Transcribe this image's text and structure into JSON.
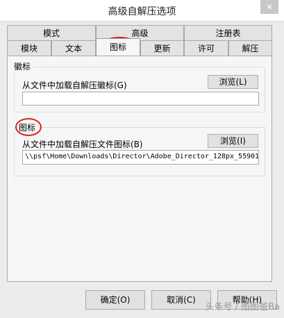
{
  "window": {
    "title": "高级自解压选项"
  },
  "tabs_row1": [
    {
      "label": "模式"
    },
    {
      "label": "高级"
    },
    {
      "label": "注册表"
    }
  ],
  "tabs_row2": [
    {
      "label": "模块"
    },
    {
      "label": "文本"
    },
    {
      "label": "图标",
      "active": true
    },
    {
      "label": "更新"
    },
    {
      "label": "许可"
    },
    {
      "label": "解压"
    }
  ],
  "logo_group": {
    "title": "徽标",
    "load_label": "从文件中加载自解压徽标(G)",
    "browse_label": "浏览(L)",
    "path_value": ""
  },
  "icon_group": {
    "title": "图标",
    "load_label": "从文件中加载自解压文件图标(B)",
    "browse_label": "浏览(I)",
    "path_value": "\\\\psf\\Home\\Downloads\\Director\\Adobe_Director_128px_55901"
  },
  "footer": {
    "ok_label": "确定(O)",
    "cancel_label": "取消(C)",
    "help_label": "帮助(H)"
  },
  "watermark": "头条号 / 图图爸Ba",
  "colors": {
    "annotation": "#e02020"
  }
}
